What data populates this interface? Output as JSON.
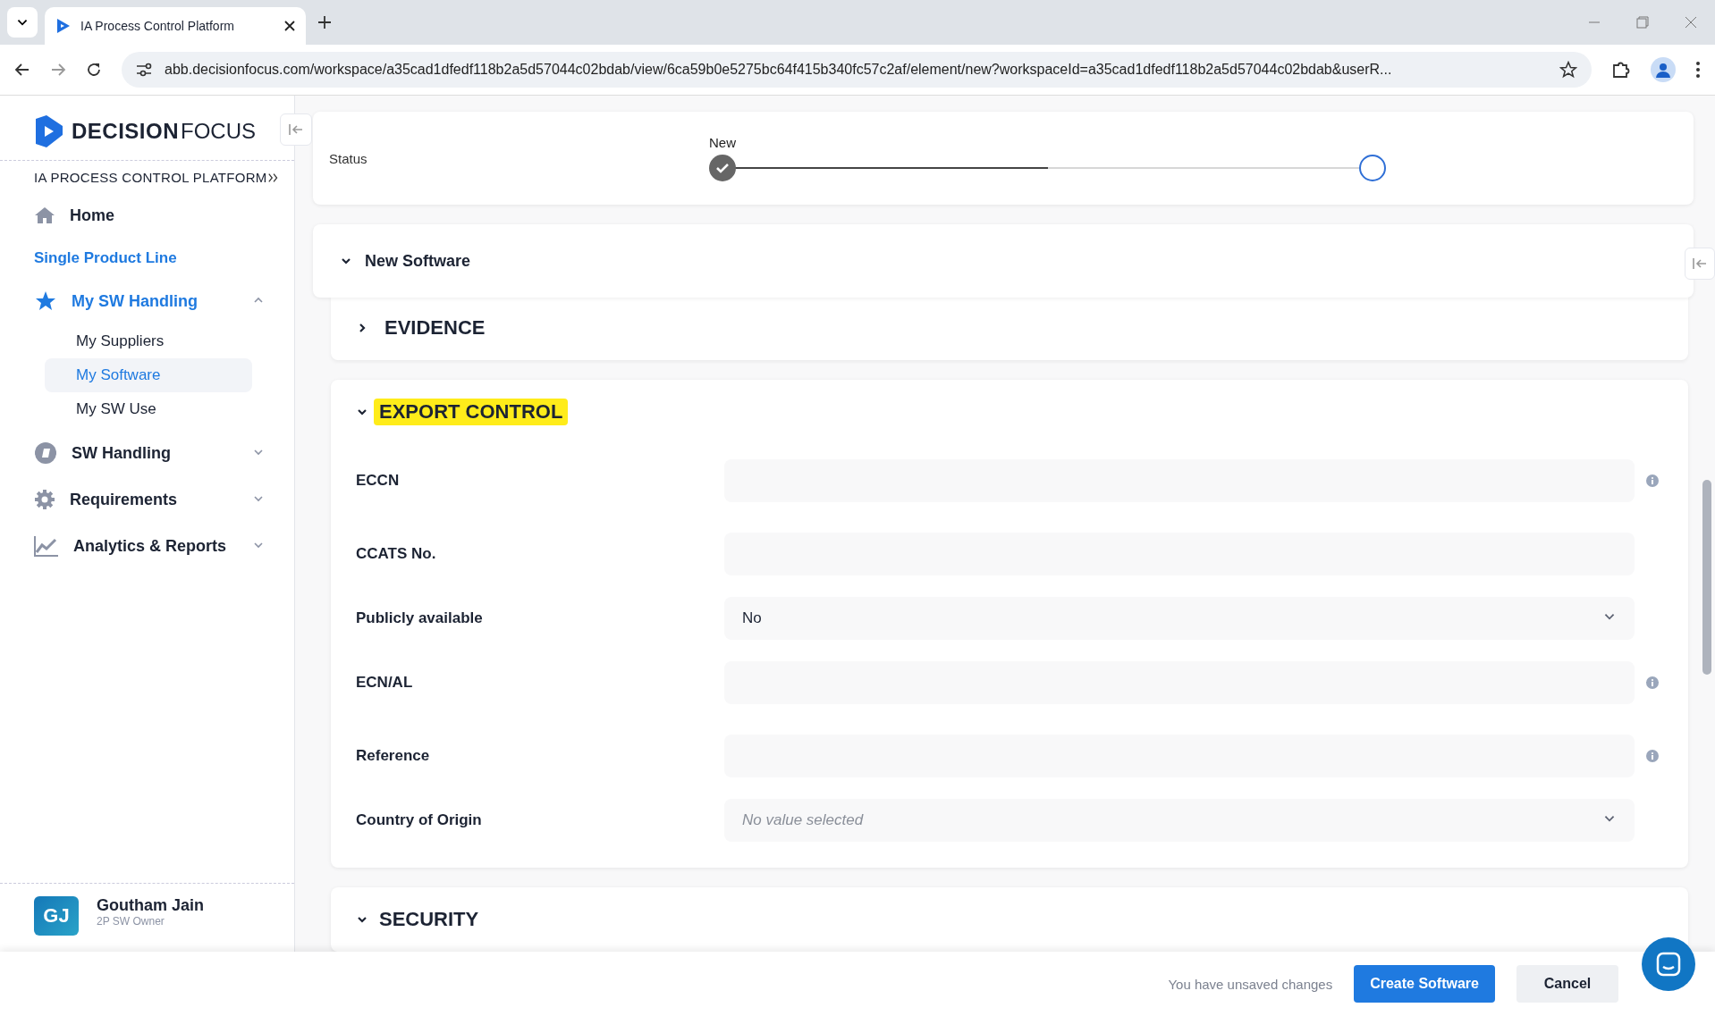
{
  "browser": {
    "tab_title": "IA Process Control Platform",
    "url": "abb.decisionfocus.com/workspace/a35cad1dfedf118b2a5d57044c02bdab/view/6ca59b0e5275bc64f415b340fc57c2af/element/new?workspaceId=a35cad1dfedf118b2a5d57044c02bdab&userR..."
  },
  "sidebar": {
    "logo_bold": "DECISION",
    "logo_light": "FOCUS",
    "platform": "IA PROCESS CONTROL PLATFORM",
    "items": [
      {
        "kind": "home",
        "label": "Home",
        "selected": false
      },
      {
        "kind": "link",
        "label": "Single Product Line",
        "selected": false
      },
      {
        "kind": "star",
        "label": "My SW Handling",
        "selected": true,
        "expanded": true,
        "children": [
          {
            "label": "My Suppliers",
            "selected": false
          },
          {
            "label": "My Software",
            "selected": true
          },
          {
            "label": "My SW Use",
            "selected": false
          }
        ]
      },
      {
        "kind": "disc",
        "label": "SW Handling",
        "selected": false,
        "expanded": false
      },
      {
        "kind": "gear",
        "label": "Requirements",
        "selected": false,
        "expanded": false
      },
      {
        "kind": "chart",
        "label": "Analytics & Reports",
        "selected": false,
        "expanded": false
      }
    ],
    "user": {
      "initials": "GJ",
      "name": "Goutham Jain",
      "role": "2P SW Owner"
    }
  },
  "status": {
    "label": "Status",
    "step_label": "New",
    "level": 0.5,
    "steps": [
      {
        "done": true
      },
      {
        "done": false
      }
    ]
  },
  "form_title": {
    "title": "New Software",
    "expanded": true
  },
  "sections": [
    {
      "title": "EVIDENCE",
      "expanded": false,
      "highlighted": false
    },
    {
      "title": "EXPORT CONTROL",
      "expanded": true,
      "highlighted": true,
      "fields": [
        {
          "kind": "text",
          "label": "ECCN",
          "info": true
        },
        {
          "kind": "text",
          "label": "CCATS No.",
          "info": false
        },
        {
          "kind": "select",
          "label": "Publicly available",
          "value": "No",
          "info": false
        },
        {
          "kind": "text",
          "label": "ECN/AL",
          "info": true
        },
        {
          "kind": "text",
          "label": "Reference",
          "info": true
        },
        {
          "kind": "select",
          "label": "Country of Origin",
          "placeholder": "No value selected",
          "info": false
        }
      ]
    },
    {
      "title": "SECURITY",
      "expanded": true,
      "highlighted": false
    }
  ],
  "footer": {
    "message": "You have unsaved changes",
    "primary": "Create Software",
    "secondary": "Cancel"
  }
}
